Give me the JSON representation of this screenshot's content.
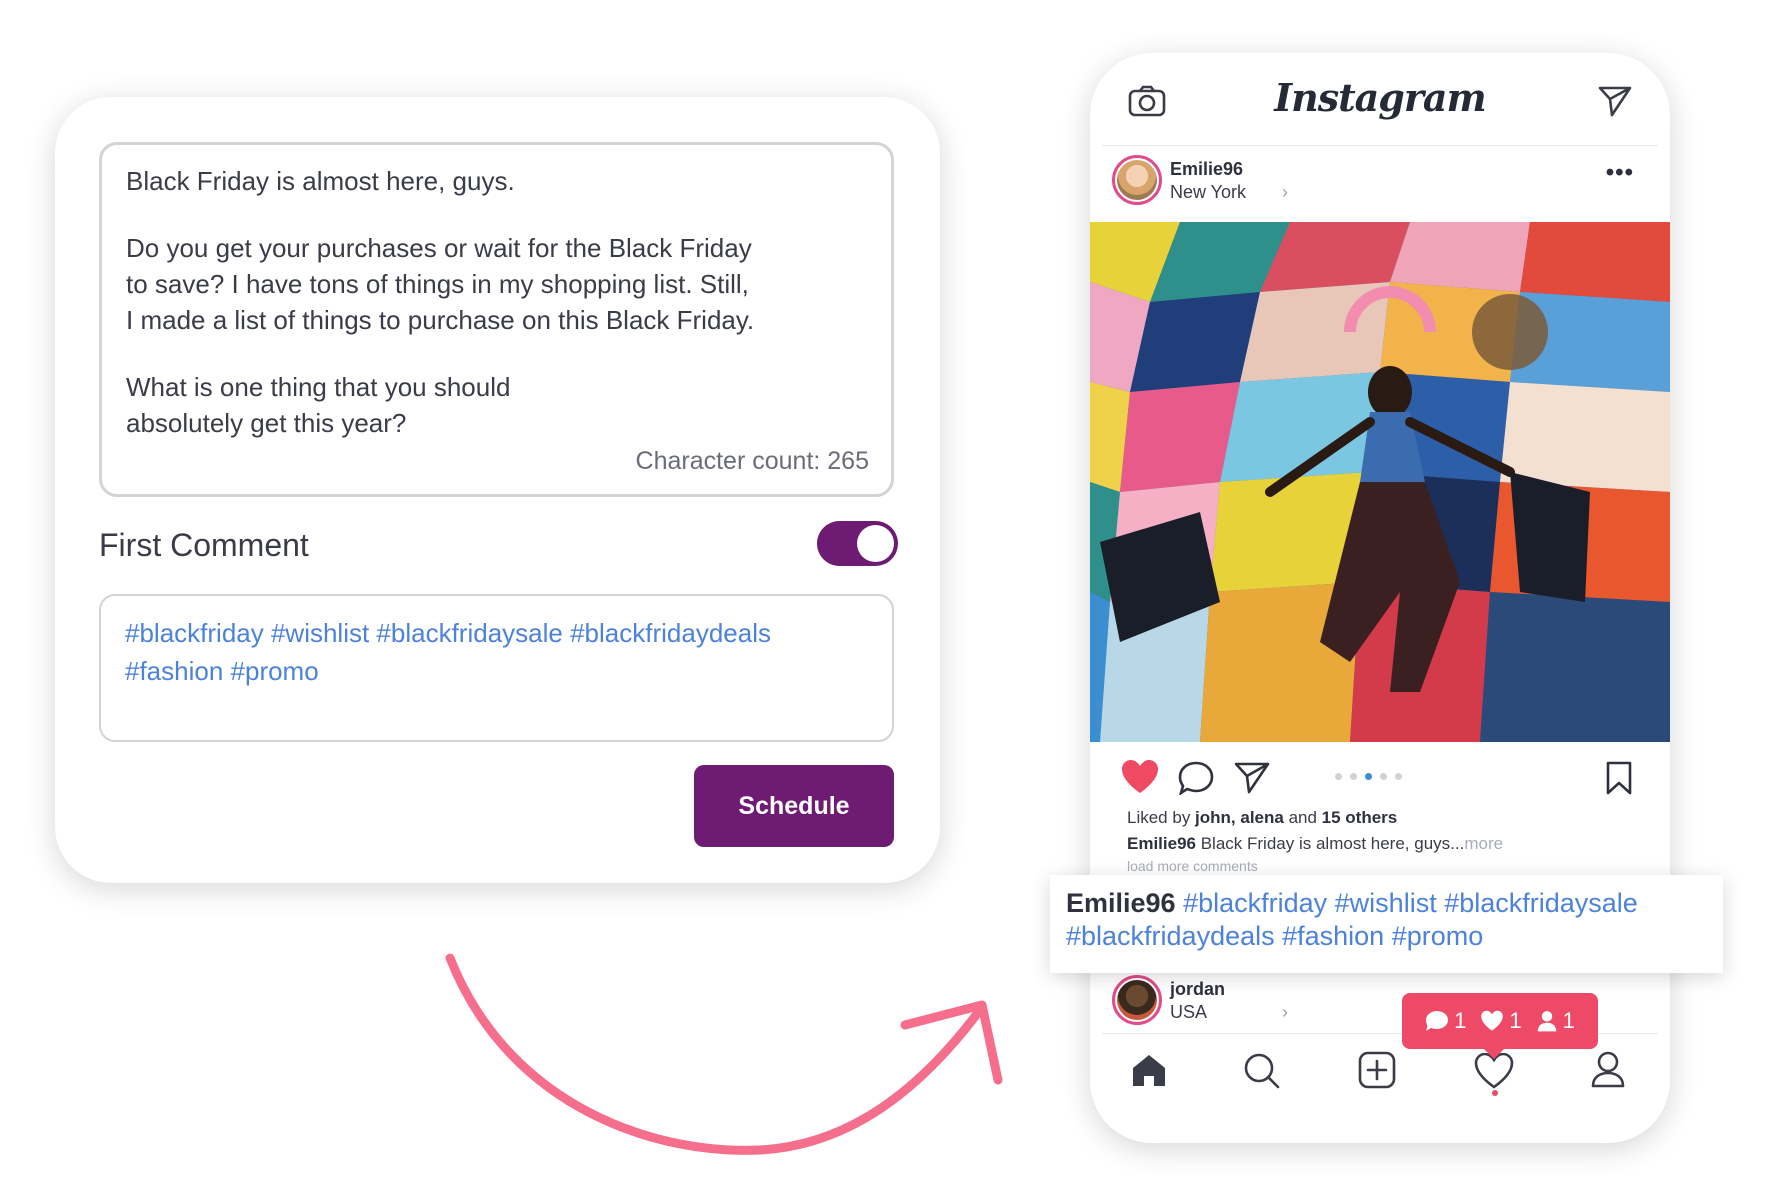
{
  "composer": {
    "caption_paragraphs": [
      "Black Friday is almost here, guys.",
      "Do you get your purchases or wait for the Black Friday\nto save? I have tons of things in my shopping list. Still,\nI  made a list of things to purchase on this Black Friday.",
      "What is one thing that you should\nabsolutely get this year?"
    ],
    "character_count": "Character count: 265",
    "first_comment_label": "First Comment",
    "first_comment_enabled": true,
    "first_comment_text": "#blackfriday #wishlist #blackfridaysale #blackfridaydeals\n#fashion #promo",
    "schedule_label": "Schedule"
  },
  "phone": {
    "app_title": "Instagram",
    "post": {
      "username": "Emilie96",
      "location": "New York",
      "liked_prefix": "Liked by ",
      "liked_users": "john, alena",
      "liked_and": " and ",
      "liked_others": "15 others",
      "caption_user": "Emilie96",
      "caption_text": " Black Friday is almost here, guys...",
      "caption_more": "more",
      "load_more": "load more comments",
      "carousel_dots": 5,
      "carousel_active": 3
    },
    "comment": {
      "username": "Emilie96",
      "tags": "#blackfriday #wishlist #blackfridaysale #blackfridaydeals #fashion #promo"
    },
    "next_post": {
      "username": "jordan",
      "location": "USA"
    },
    "notifications": {
      "comments": "1",
      "likes": "1",
      "followers": "1"
    }
  },
  "colors": {
    "accent_purple": "#6d1b73",
    "hashtag_blue": "#4c82dc",
    "notification_red": "#ee4a67",
    "arrow_pink": "#f56f8c"
  }
}
